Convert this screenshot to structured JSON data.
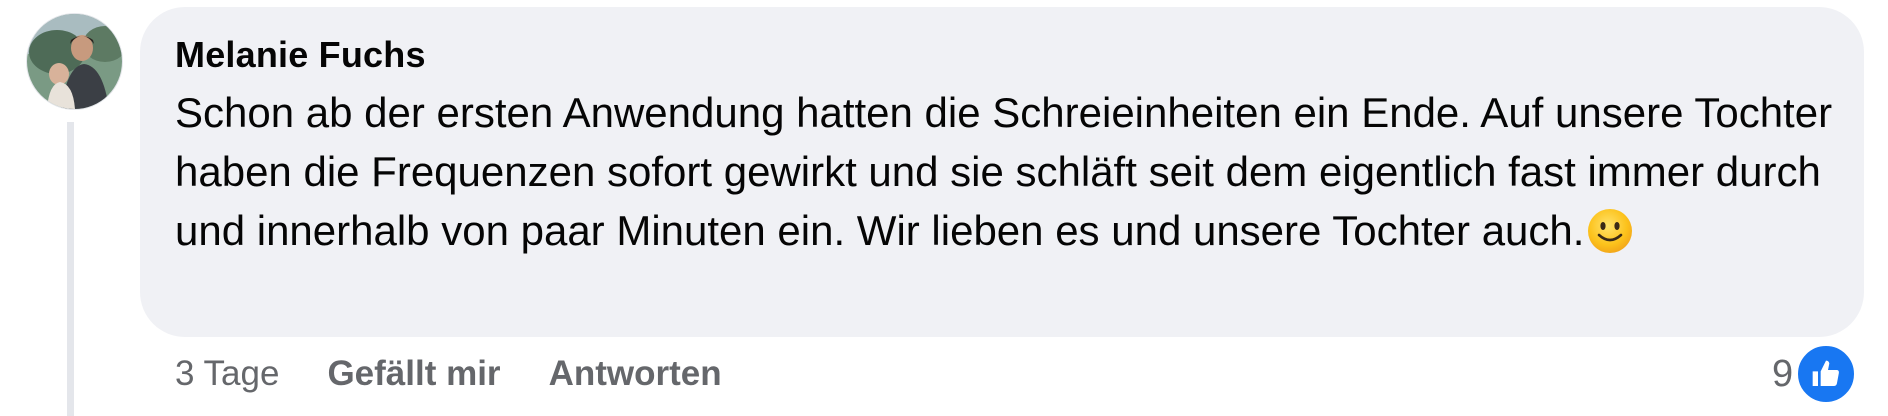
{
  "comment": {
    "author": "Melanie Fuchs",
    "text": "Schon ab der ersten Anwendung hatten die Schreieinheiten ein Ende. Auf unsere Tochter haben die Frequenzen sofort gewirkt und sie schläft seit dem eigentlich fast immer durch und innerhalb von paar Minuten ein. Wir lieben es und unsere Tochter auch.",
    "emoji": "slightly-smiling-face",
    "timestamp": "3 Tage",
    "like_label": "Gefällt mir",
    "reply_label": "Antworten",
    "reaction_count": "9",
    "reaction_icon": "thumbs-up-icon"
  },
  "colors": {
    "bubble": "#f0f1f5",
    "meta_text": "#65676b",
    "like_badge": "#1877f2",
    "thread_line": "#e4e6eb"
  }
}
